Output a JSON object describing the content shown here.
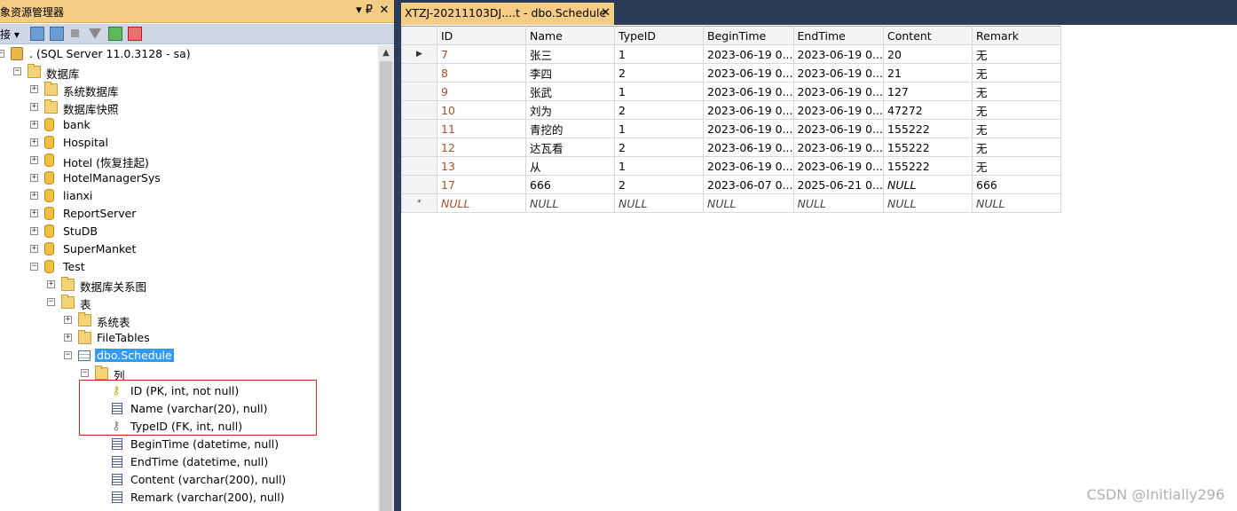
{
  "object_explorer": {
    "title": "象资源管理器",
    "pin_glyph": "▾ ₽",
    "close_glyph": "✕",
    "toolbar": {
      "connect_label": "连接 ▾"
    },
    "tree": [
      {
        "label": ". (SQL Server 11.0.3128 - sa)",
        "icon": "server-icon",
        "exp": "−",
        "indent": 0
      },
      {
        "label": "数据库",
        "icon": "folder-icon",
        "exp": "−",
        "indent": 1
      },
      {
        "label": "系统数据库",
        "icon": "folder-icon",
        "exp": "+",
        "indent": 2
      },
      {
        "label": "数据库快照",
        "icon": "folder-icon",
        "exp": "+",
        "indent": 2
      },
      {
        "label": "bank",
        "icon": "database-icon",
        "exp": "+",
        "indent": 2
      },
      {
        "label": "Hospital",
        "icon": "database-icon",
        "exp": "+",
        "indent": 2
      },
      {
        "label": "Hotel (恢复挂起)",
        "icon": "database-icon",
        "exp": "+",
        "indent": 2
      },
      {
        "label": "HotelManagerSys",
        "icon": "database-icon",
        "exp": "+",
        "indent": 2
      },
      {
        "label": "lianxi",
        "icon": "database-icon",
        "exp": "+",
        "indent": 2
      },
      {
        "label": "ReportServer",
        "icon": "database-icon",
        "exp": "+",
        "indent": 2
      },
      {
        "label": "StuDB",
        "icon": "database-icon",
        "exp": "+",
        "indent": 2
      },
      {
        "label": "SuperManket",
        "icon": "database-icon",
        "exp": "+",
        "indent": 2
      },
      {
        "label": "Test",
        "icon": "database-icon",
        "exp": "−",
        "indent": 2
      },
      {
        "label": "数据库关系图",
        "icon": "folder-icon",
        "exp": "+",
        "indent": 3
      },
      {
        "label": "表",
        "icon": "folder-icon",
        "exp": "−",
        "indent": 3
      },
      {
        "label": "系统表",
        "icon": "folder-icon",
        "exp": "+",
        "indent": 4
      },
      {
        "label": "FileTables",
        "icon": "folder-icon",
        "exp": "+",
        "indent": 4
      },
      {
        "label": "dbo.Schedule",
        "icon": "table-icon",
        "exp": "−",
        "indent": 4,
        "selected": true
      },
      {
        "label": "列",
        "icon": "folder-icon",
        "exp": "−",
        "indent": 5
      },
      {
        "label": "ID (PK, int, not null)",
        "icon": "primary-key-icon",
        "exp": "",
        "indent": 6
      },
      {
        "label": "Name (varchar(20), null)",
        "icon": "column-icon",
        "exp": "",
        "indent": 6
      },
      {
        "label": "TypeID (FK, int, null)",
        "icon": "foreign-key-icon",
        "exp": "",
        "indent": 6
      },
      {
        "label": "BeginTime (datetime, null)",
        "icon": "column-icon",
        "exp": "",
        "indent": 6
      },
      {
        "label": "EndTime (datetime, null)",
        "icon": "column-icon",
        "exp": "",
        "indent": 6
      },
      {
        "label": "Content (varchar(200), null)",
        "icon": "column-icon",
        "exp": "",
        "indent": 6
      },
      {
        "label": "Remark (varchar(200), null)",
        "icon": "column-icon",
        "exp": "",
        "indent": 6
      }
    ]
  },
  "document": {
    "tab_label": "XTZJ-20211103DJ....t - dbo.Schedule",
    "tab_close": "✕",
    "grid": {
      "columns": [
        "ID",
        "Name",
        "TypeID",
        "BeginTime",
        "EndTime",
        "Content",
        "Remark"
      ],
      "rows": [
        {
          "marker": "▶",
          "cells": [
            "7",
            "张三",
            "1",
            "2023-06-19 0...",
            "2023-06-19 0...",
            "20",
            "无"
          ]
        },
        {
          "marker": "",
          "cells": [
            "8",
            "李四",
            "2",
            "2023-06-19 0...",
            "2023-06-19 0...",
            "21",
            "无"
          ]
        },
        {
          "marker": "",
          "cells": [
            "9",
            "张武",
            "1",
            "2023-06-19 0...",
            "2023-06-19 0...",
            "127",
            "无"
          ]
        },
        {
          "marker": "",
          "cells": [
            "10",
            "刘为",
            "2",
            "2023-06-19 0...",
            "2023-06-19 0...",
            "47272",
            "无"
          ]
        },
        {
          "marker": "",
          "cells": [
            "11",
            "青挖的",
            "1",
            "2023-06-19 0...",
            "2023-06-19 0...",
            "155222",
            "无"
          ]
        },
        {
          "marker": "",
          "cells": [
            "12",
            "达瓦看",
            "2",
            "2023-06-19 0...",
            "2023-06-19 0...",
            "155222",
            "无"
          ]
        },
        {
          "marker": "",
          "cells": [
            "13",
            "从",
            "1",
            "2023-06-19 0...",
            "2023-06-19 0...",
            "155222",
            "无"
          ]
        },
        {
          "marker": "",
          "cells": [
            "17",
            "666",
            "2",
            "2023-06-07 0...",
            "2025-06-21 0...",
            "NULL",
            "666"
          ]
        },
        {
          "marker": "*",
          "cells": [
            "NULL",
            "NULL",
            "NULL",
            "NULL",
            "NULL",
            "NULL",
            "NULL"
          ]
        }
      ]
    }
  },
  "watermark": "CSDN @Initially296",
  "colors": {
    "tab_gold": "#f5cc84",
    "navy": "#2b3c59",
    "selection": "#3399ff",
    "id_text": "#a0522d",
    "highlight": "#d02020"
  }
}
